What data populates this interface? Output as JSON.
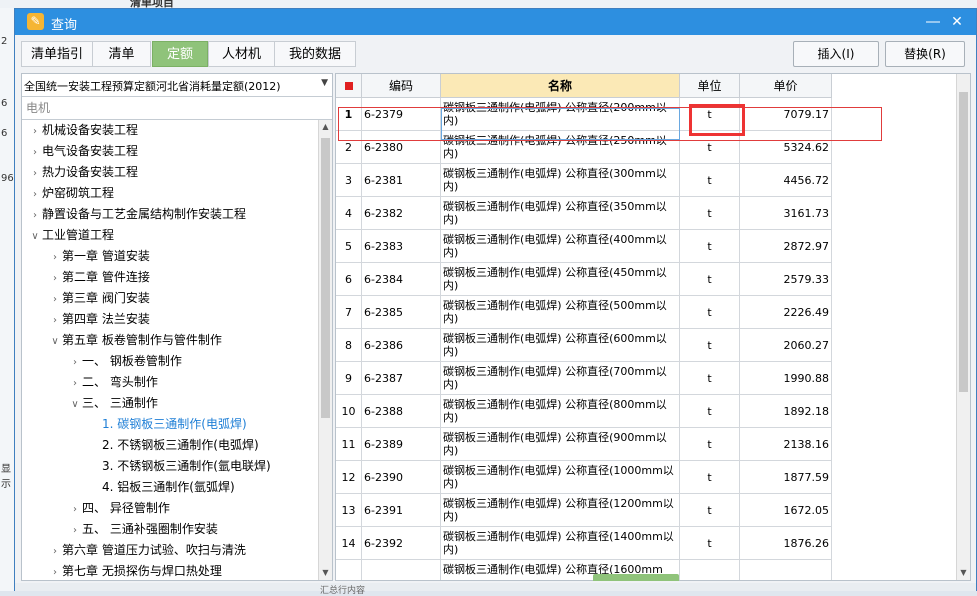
{
  "background": {
    "title": "清单项目",
    "edge_labels": [
      "2",
      "6",
      "6",
      "96",
      "显示"
    ]
  },
  "window": {
    "title": "查询",
    "minimize": "―",
    "close": "✕"
  },
  "tabs": [
    {
      "label": "清单指引",
      "active": false
    },
    {
      "label": "清单",
      "active": false
    },
    {
      "label": "定额",
      "active": true
    },
    {
      "label": "人材机",
      "active": false
    },
    {
      "label": "我的数据",
      "active": false
    }
  ],
  "actions": {
    "insert": "插入(I)",
    "replace": "替换(R)"
  },
  "quota_select": {
    "value": "全国统一安装工程预算定额河北省消耗量定额(2012)"
  },
  "search": {
    "placeholder": "电机"
  },
  "tree": [
    {
      "label": "机械设备安装工程",
      "level": 0,
      "expanded": false
    },
    {
      "label": "电气设备安装工程",
      "level": 0,
      "expanded": false
    },
    {
      "label": "热力设备安装工程",
      "level": 0,
      "expanded": false
    },
    {
      "label": "炉窑砌筑工程",
      "level": 0,
      "expanded": false
    },
    {
      "label": "静置设备与工艺金属结构制作安装工程",
      "level": 0,
      "expanded": false
    },
    {
      "label": "工业管道工程",
      "level": 0,
      "expanded": true
    },
    {
      "label": "第一章 管道安装",
      "level": 1,
      "expanded": false
    },
    {
      "label": "第二章 管件连接",
      "level": 1,
      "expanded": false
    },
    {
      "label": "第三章 阀门安装",
      "level": 1,
      "expanded": false
    },
    {
      "label": "第四章 法兰安装",
      "level": 1,
      "expanded": false
    },
    {
      "label": "第五章 板卷管制作与管件制作",
      "level": 1,
      "expanded": true
    },
    {
      "label": "一、 钢板卷管制作",
      "level": 2,
      "expanded": false
    },
    {
      "label": "二、 弯头制作",
      "level": 2,
      "expanded": false
    },
    {
      "label": "三、 三通制作",
      "level": 2,
      "expanded": true
    },
    {
      "label": "1. 碳钢板三通制作(电弧焊)",
      "level": 3,
      "leaf": true,
      "selected": true
    },
    {
      "label": "2. 不锈钢板三通制作(电弧焊)",
      "level": 3,
      "leaf": true
    },
    {
      "label": "3. 不锈钢板三通制作(氩电联焊)",
      "level": 3,
      "leaf": true
    },
    {
      "label": "4. 铝板三通制作(氩弧焊)",
      "level": 3,
      "leaf": true
    },
    {
      "label": "四、 异径管制作",
      "level": 2,
      "expanded": false
    },
    {
      "label": "五、 三通补强圈制作安装",
      "level": 2,
      "expanded": false
    },
    {
      "label": "第六章 管道压力试验、吹扫与清洗",
      "level": 1,
      "expanded": false
    },
    {
      "label": "第七章 无损探伤与焊口热处理",
      "level": 1,
      "expanded": false
    }
  ],
  "table": {
    "headers": {
      "code": "编码",
      "name": "名称",
      "unit": "单位",
      "price": "单价"
    },
    "rows": [
      {
        "no": "1",
        "code": "6-2379",
        "name": "碳钢板三通制作(电弧焊) 公称直径(200mm以内)",
        "unit": "t",
        "price": "7079.17"
      },
      {
        "no": "2",
        "code": "6-2380",
        "name": "碳钢板三通制作(电弧焊) 公称直径(250mm以内)",
        "unit": "t",
        "price": "5324.62"
      },
      {
        "no": "3",
        "code": "6-2381",
        "name": "碳钢板三通制作(电弧焊) 公称直径(300mm以内)",
        "unit": "t",
        "price": "4456.72"
      },
      {
        "no": "4",
        "code": "6-2382",
        "name": "碳钢板三通制作(电弧焊) 公称直径(350mm以内)",
        "unit": "t",
        "price": "3161.73"
      },
      {
        "no": "5",
        "code": "6-2383",
        "name": "碳钢板三通制作(电弧焊) 公称直径(400mm以内)",
        "unit": "t",
        "price": "2872.97"
      },
      {
        "no": "6",
        "code": "6-2384",
        "name": "碳钢板三通制作(电弧焊) 公称直径(450mm以内)",
        "unit": "t",
        "price": "2579.33"
      },
      {
        "no": "7",
        "code": "6-2385",
        "name": "碳钢板三通制作(电弧焊) 公称直径(500mm以内)",
        "unit": "t",
        "price": "2226.49"
      },
      {
        "no": "8",
        "code": "6-2386",
        "name": "碳钢板三通制作(电弧焊) 公称直径(600mm以内)",
        "unit": "t",
        "price": "2060.27"
      },
      {
        "no": "9",
        "code": "6-2387",
        "name": "碳钢板三通制作(电弧焊) 公称直径(700mm以内)",
        "unit": "t",
        "price": "1990.88"
      },
      {
        "no": "10",
        "code": "6-2388",
        "name": "碳钢板三通制作(电弧焊) 公称直径(800mm以内)",
        "unit": "t",
        "price": "1892.18"
      },
      {
        "no": "11",
        "code": "6-2389",
        "name": "碳钢板三通制作(电弧焊) 公称直径(900mm以内)",
        "unit": "t",
        "price": "2138.16"
      },
      {
        "no": "12",
        "code": "6-2390",
        "name": "碳钢板三通制作(电弧焊) 公称直径(1000mm以内)",
        "unit": "t",
        "price": "1877.59"
      },
      {
        "no": "13",
        "code": "6-2391",
        "name": "碳钢板三通制作(电弧焊) 公称直径(1200mm以内)",
        "unit": "t",
        "price": "1672.05"
      },
      {
        "no": "14",
        "code": "6-2392",
        "name": "碳钢板三通制作(电弧焊) 公称直径(1400mm以内)",
        "unit": "t",
        "price": "1876.26"
      },
      {
        "no": "",
        "code": "",
        "name": "碳钢板三通制作(电弧焊) 公称直径(1600mm",
        "unit": "",
        "price": ""
      }
    ]
  },
  "bottom_text": "汇总行内容",
  "colors": {
    "titlebar": "#2d8fe0",
    "active_tab": "#8fc37a",
    "name_header": "#fbe9b6",
    "highlight_red": "#ee3333"
  }
}
